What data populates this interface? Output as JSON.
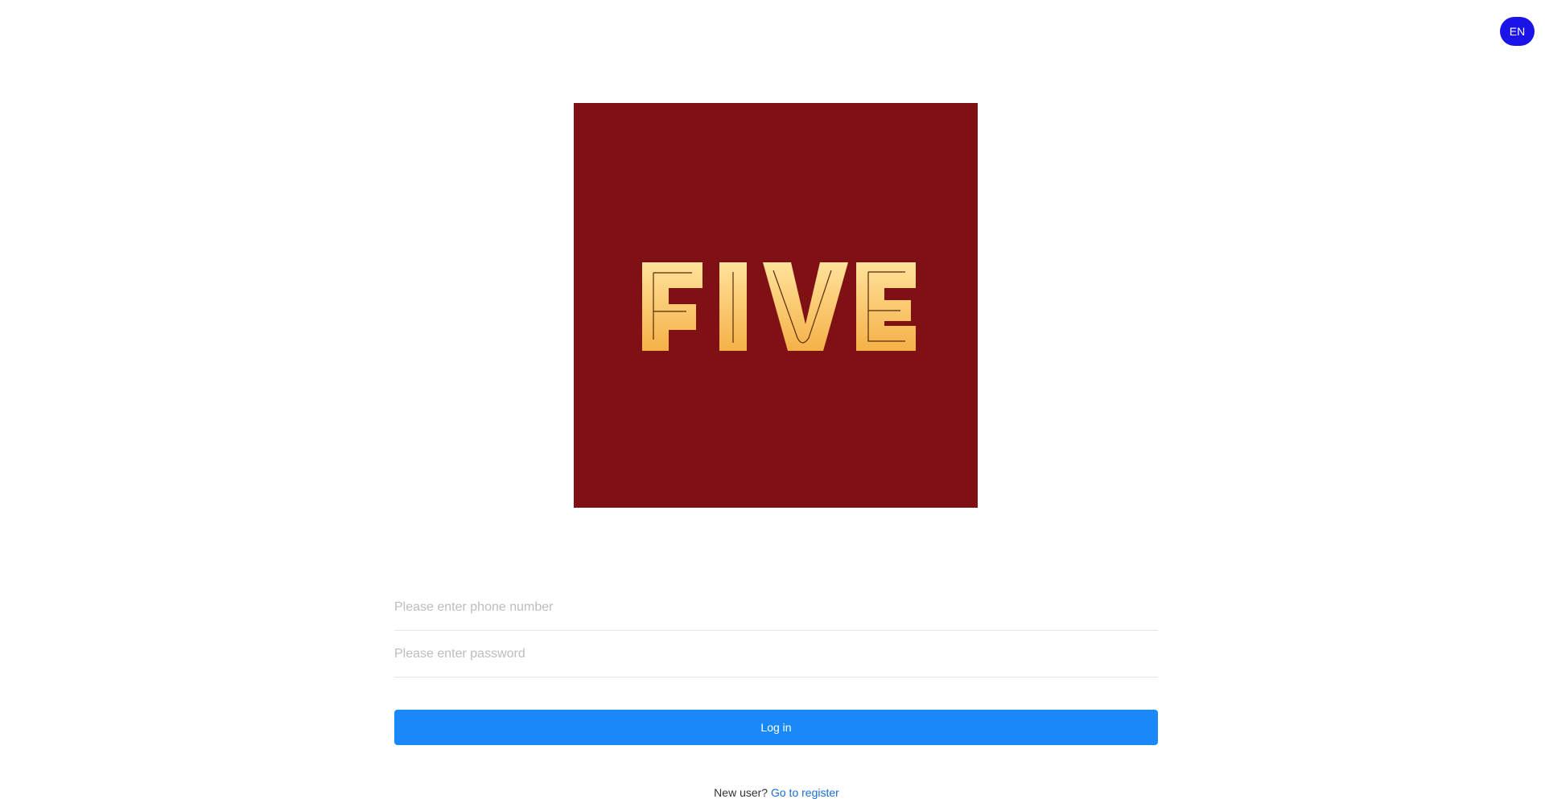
{
  "header": {
    "language_label": "EN"
  },
  "logo": {
    "text": "FIVE",
    "background_color": "#7f1115",
    "letter_color_top": "#ffe29a",
    "letter_color_bottom": "#f5b148"
  },
  "form": {
    "phone_placeholder": "Please enter phone number",
    "phone_value": "",
    "password_placeholder": "Please enter password",
    "password_value": "",
    "login_label": "Log in"
  },
  "footer": {
    "new_user_text": "New user?",
    "register_link": "Go to register"
  },
  "colors": {
    "primary_button": "#1989fa",
    "language_button": "#1a14e8",
    "link": "#1a6fd6"
  }
}
